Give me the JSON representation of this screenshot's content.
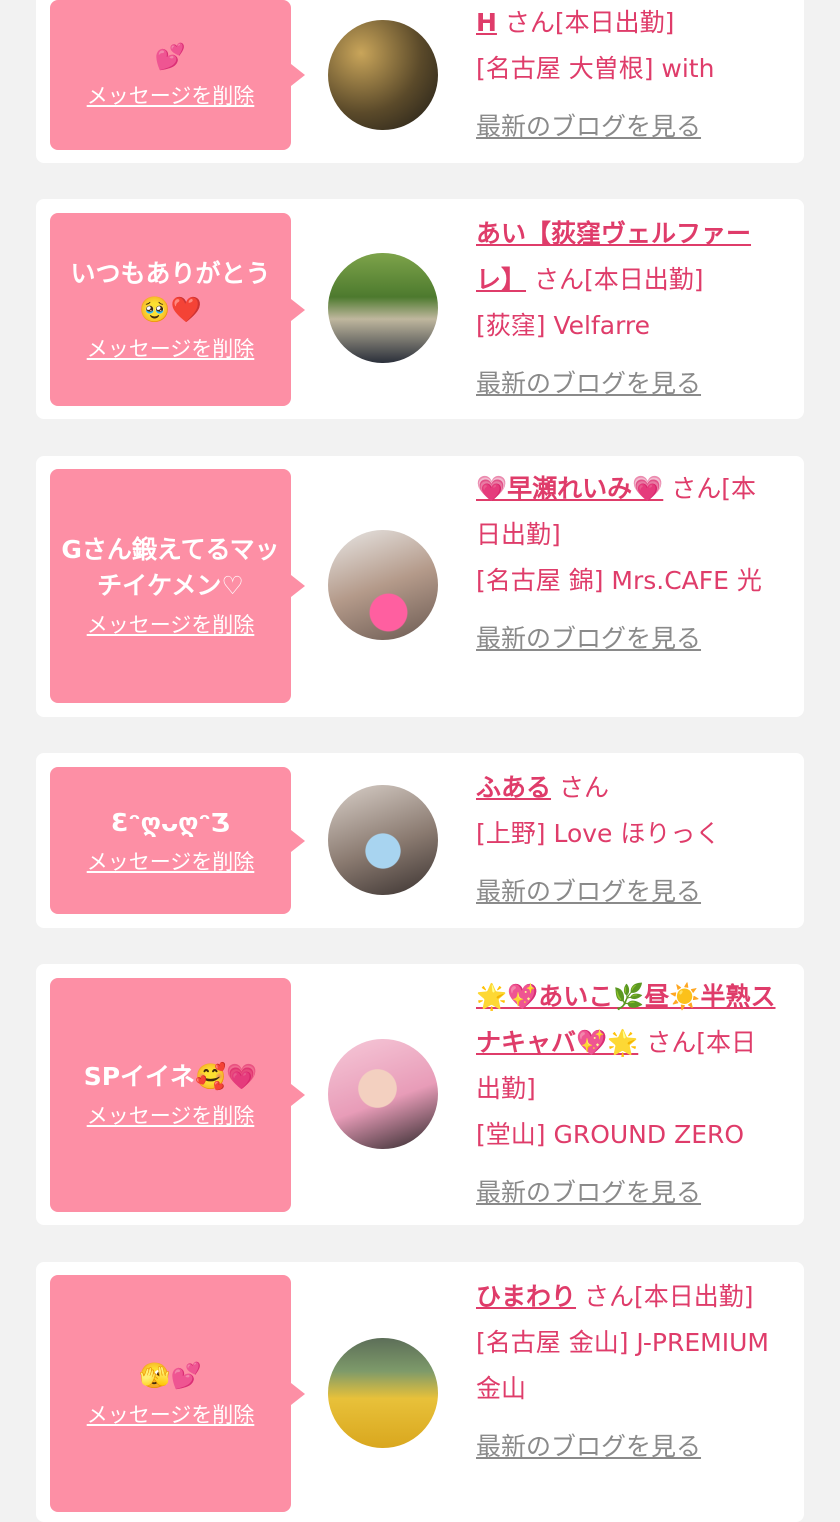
{
  "delete_label": "メッセージを削除",
  "blog_label": "最新のブログを見る",
  "colors": {
    "accent": "#df3c6a",
    "bubble": "#fd8fa5",
    "background": "#f2f2f2"
  },
  "entries": [
    {
      "message": "💕",
      "name": "H",
      "san": "さん[本日出勤]",
      "shop": "[名古屋 大曽根] with"
    },
    {
      "message": "いつもありがとう🥹❤️",
      "name": "あい【荻窪ヴェルファーレ】",
      "san": "さん[本日出勤]",
      "shop": "[荻窪] Velfarre"
    },
    {
      "message": "Gさん鍛えてるマッチイケメン♡",
      "name": "💗早瀬れいみ💗",
      "san": "さん[本日出勤]",
      "shop": "[名古屋 錦] Mrs.CAFE 光"
    },
    {
      "message": "ƐᵔღᴗღᵔƷ",
      "name": "ふある",
      "san": "さん",
      "shop": "[上野] Love ほりっく"
    },
    {
      "message": "SPイイネ🥰💗",
      "name": "🌟💖あいこ🌿昼☀️半熟スナキャバ💖🌟",
      "san": "さん[本日出勤]",
      "shop": "[堂山] GROUND ZERO"
    },
    {
      "message": "🫣💕",
      "name": "ひまわり",
      "san": "さん[本日出勤]",
      "shop": "[名古屋 金山] J-PREMIUM 金山"
    }
  ]
}
